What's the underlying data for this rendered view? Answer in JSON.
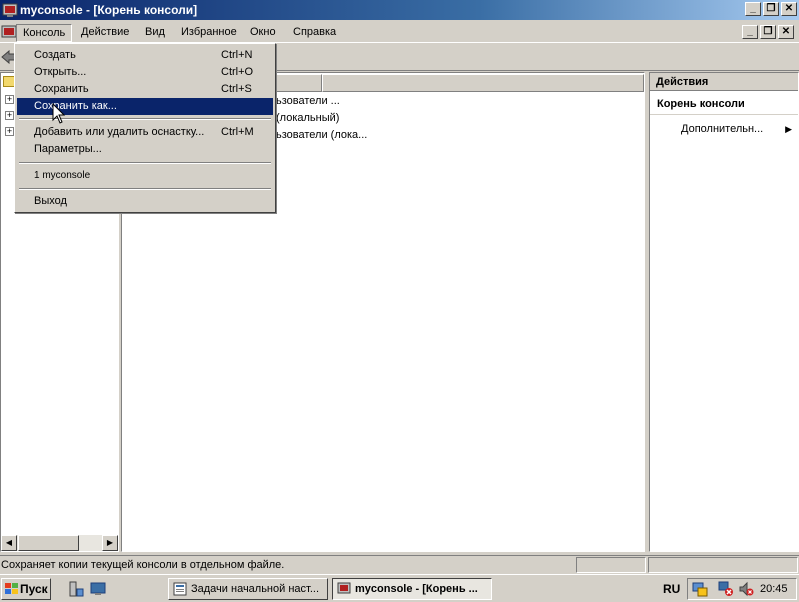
{
  "window": {
    "title": "myconsole - [Корень консоли]"
  },
  "menubar": {
    "items": [
      {
        "label": "Консоль"
      },
      {
        "label": "Действие"
      },
      {
        "label": "Вид"
      },
      {
        "label": "Избранное"
      },
      {
        "label": "Окно"
      },
      {
        "label": "Справка"
      }
    ]
  },
  "console_menu": {
    "items": [
      {
        "label": "Создать",
        "shortcut": "Ctrl+N"
      },
      {
        "label": "Открыть...",
        "shortcut": "Ctrl+O"
      },
      {
        "label": "Сохранить",
        "shortcut": "Ctrl+S"
      },
      {
        "label": "Сохранить как...",
        "shortcut": ""
      },
      {
        "label": "Добавить или удалить оснастку...",
        "shortcut": "Ctrl+M"
      },
      {
        "label": "Параметры...",
        "shortcut": ""
      },
      {
        "label": "1 myconsole",
        "shortcut": ""
      },
      {
        "label": "Выход",
        "shortcut": ""
      }
    ],
    "selected": "Сохранить как..."
  },
  "center": {
    "rows": [
      {
        "text": "ьзователи ..."
      },
      {
        "text": "(локальный)"
      },
      {
        "text": "ьзователи (лока..."
      }
    ]
  },
  "actions": {
    "header": "Действия",
    "section": "Корень консоли",
    "more": "Дополнительн..."
  },
  "status": {
    "text": "Сохраняет копии текущей консоли в отдельном файле."
  },
  "taskbar": {
    "start": "Пуск",
    "tasks": [
      {
        "label": "Задачи начальной наст..."
      },
      {
        "label": "myconsole - [Корень ..."
      }
    ],
    "language": "RU",
    "clock": "20:45"
  },
  "icons": {
    "app": "mmc-console-icon",
    "back": "back-arrow-icon",
    "folder": "folder-icon",
    "cursor": "mouse-pointer-icon"
  }
}
